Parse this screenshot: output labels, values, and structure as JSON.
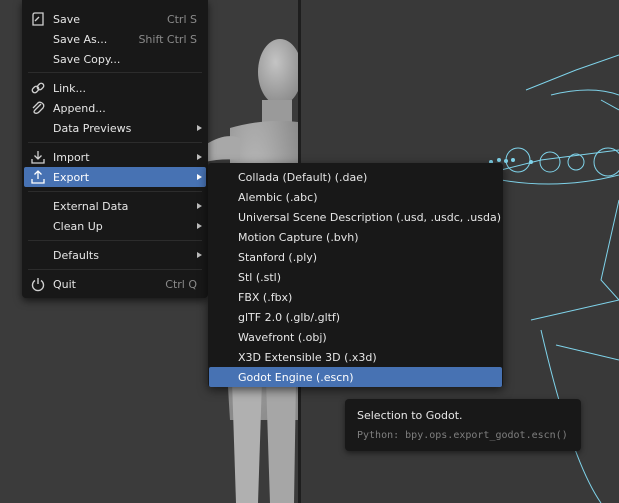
{
  "file_menu": {
    "items": [
      {
        "label": "Save",
        "shortcut": "Ctrl S",
        "icon": "save-icon"
      },
      {
        "label": "Save As...",
        "shortcut": "Shift Ctrl S"
      },
      {
        "label": "Save Copy..."
      },
      {
        "label": "Link...",
        "icon": "link-icon"
      },
      {
        "label": "Append...",
        "icon": "append-icon"
      },
      {
        "label": "Data Previews",
        "has_submenu": true
      },
      {
        "label": "Import",
        "icon": "import-icon",
        "has_submenu": true
      },
      {
        "label": "Export",
        "icon": "export-icon",
        "has_submenu": true,
        "highlighted": true
      },
      {
        "label": "External Data",
        "has_submenu": true
      },
      {
        "label": "Clean Up",
        "has_submenu": true
      },
      {
        "label": "Defaults",
        "has_submenu": true
      },
      {
        "label": "Quit",
        "shortcut": "Ctrl Q",
        "icon": "quit-icon"
      }
    ]
  },
  "export_submenu": {
    "items": [
      {
        "label": "Collada (Default) (.dae)"
      },
      {
        "label": "Alembic (.abc)"
      },
      {
        "label": "Universal Scene Description (.usd, .usdc, .usda)"
      },
      {
        "label": "Motion Capture (.bvh)"
      },
      {
        "label": "Stanford (.ply)"
      },
      {
        "label": "Stl (.stl)"
      },
      {
        "label": "FBX (.fbx)"
      },
      {
        "label": "glTF 2.0 (.glb/.gltf)"
      },
      {
        "label": "Wavefront (.obj)"
      },
      {
        "label": "X3D Extensible 3D (.x3d)"
      },
      {
        "label": "Godot Engine (.escn)",
        "highlighted": true
      }
    ]
  },
  "tooltip": {
    "description": "Selection to Godot.",
    "python": "Python: bpy.ops.export_godot.escn()"
  },
  "colors": {
    "menu_bg": "#181818",
    "highlight": "#4772b3",
    "armature": "#7fd3ea",
    "shortcut_text": "#8a8a8a"
  }
}
